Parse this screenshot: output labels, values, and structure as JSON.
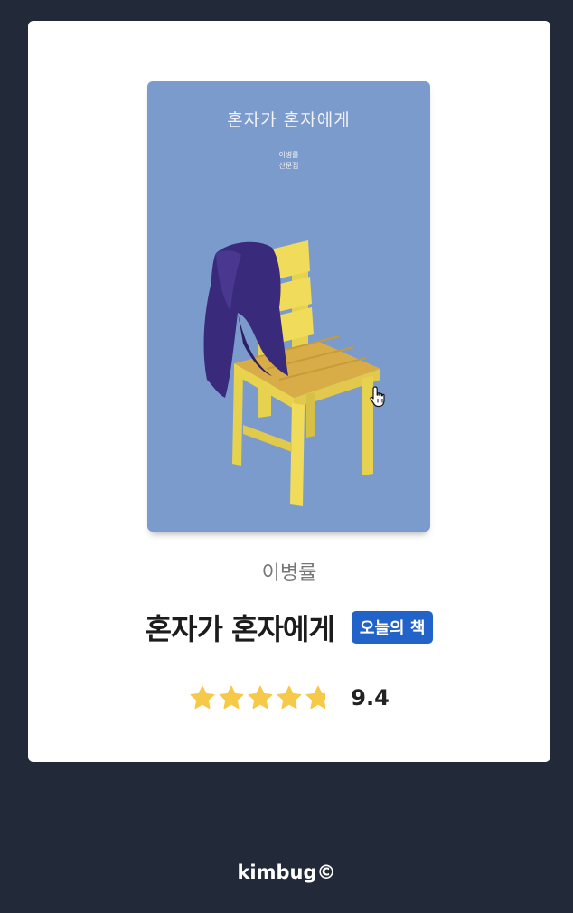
{
  "card": {
    "cover": {
      "title": "혼자가 혼자에게",
      "author_line": "이병률",
      "publisher_line": "산문집",
      "bg_color": "#7b9bcd"
    },
    "author": "이병률",
    "title": "혼자가 혼자에게",
    "badge": "오늘의 책",
    "badge_color": "#2163c8",
    "rating": {
      "value_text": "9.4",
      "stars_max": 5,
      "stars_filled": 4.7,
      "star_color": "#f7c948"
    }
  },
  "footer": {
    "text": "kimbug©"
  },
  "icons": {
    "cursor": "hand-pointer-icon",
    "star": "star-icon"
  }
}
